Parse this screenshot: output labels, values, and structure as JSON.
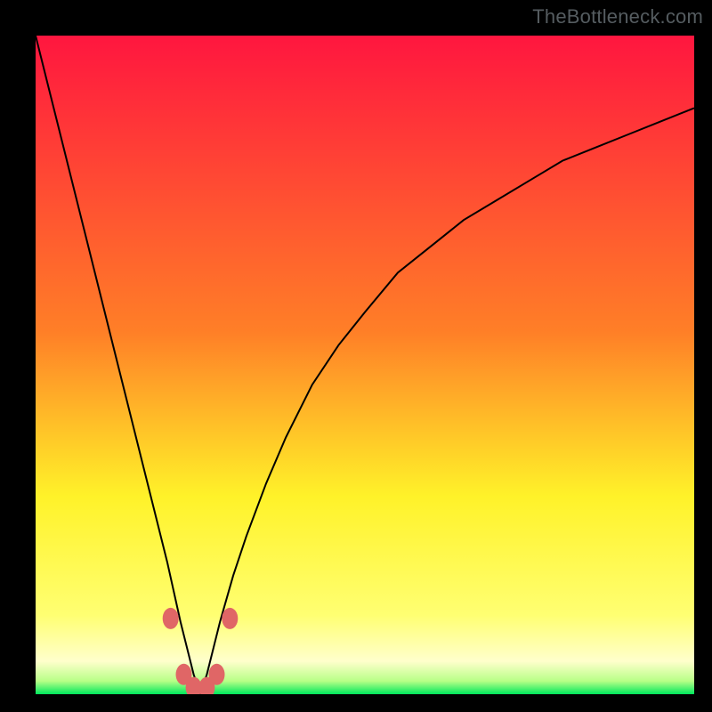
{
  "watermark": "TheBottleneck.com",
  "chart_data": {
    "type": "line",
    "title": "",
    "xlabel": "",
    "ylabel": "",
    "xlim": [
      0,
      100
    ],
    "ylim": [
      0,
      100
    ],
    "grid": false,
    "annotations": [],
    "optimum_x": 25,
    "background_gradient": {
      "stops": [
        {
          "y": 100,
          "color": "#ff163f"
        },
        {
          "y": 55,
          "color": "#ff7f27"
        },
        {
          "y": 30,
          "color": "#fff229"
        },
        {
          "y": 12,
          "color": "#ffff72"
        },
        {
          "y": 5,
          "color": "#ffffcc"
        },
        {
          "y": 2,
          "color": "#b8ff87"
        },
        {
          "y": 0,
          "color": "#00e85c"
        }
      ]
    },
    "series": [
      {
        "name": "bottleneck-curve",
        "x": [
          0,
          2,
          4,
          6,
          8,
          10,
          12,
          14,
          16,
          18,
          20,
          22,
          23,
          24,
          25,
          26,
          27,
          28,
          30,
          32,
          35,
          38,
          42,
          46,
          50,
          55,
          60,
          65,
          70,
          75,
          80,
          85,
          90,
          95,
          100
        ],
        "y": [
          100,
          92,
          84,
          76,
          68,
          60,
          52,
          44,
          36,
          28,
          20,
          11,
          7,
          3,
          0,
          3,
          7,
          11,
          18,
          24,
          32,
          39,
          47,
          53,
          58,
          64,
          68,
          72,
          75,
          78,
          81,
          83,
          85,
          87,
          89
        ]
      }
    ],
    "markers": [
      {
        "x": 20.5,
        "y": 11.5
      },
      {
        "x": 22.5,
        "y": 3.0
      },
      {
        "x": 24.0,
        "y": 1.0
      },
      {
        "x": 26.0,
        "y": 1.0
      },
      {
        "x": 27.5,
        "y": 3.0
      },
      {
        "x": 29.5,
        "y": 11.5
      }
    ],
    "marker_color": "#e06666",
    "curve_color": "#000000"
  }
}
